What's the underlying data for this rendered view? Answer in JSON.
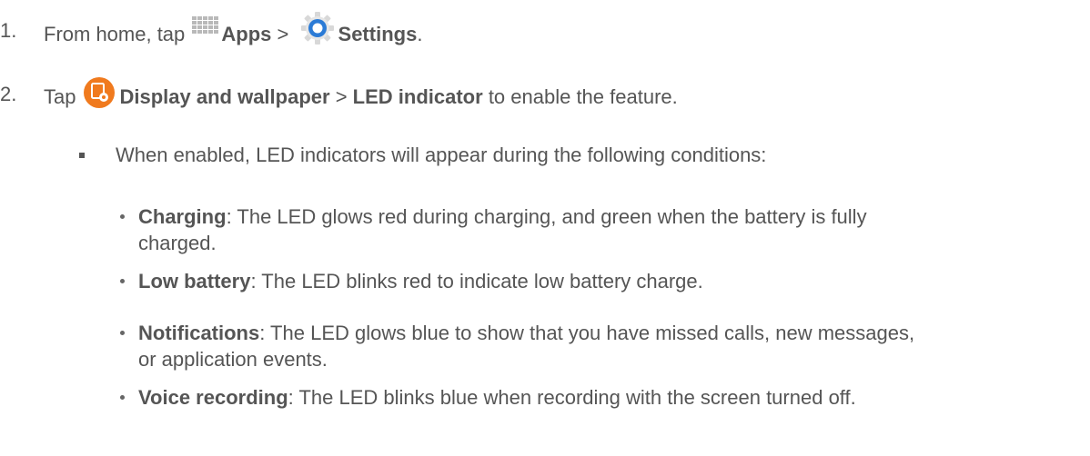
{
  "step1": {
    "number": "1.",
    "text_before": "From home, tap",
    "apps_label": "Apps",
    "separator": ">",
    "settings_label": "Settings",
    "end": "."
  },
  "step2": {
    "number": "2.",
    "text_before": "Tap",
    "display_label": "Display and wallpaper",
    "separator": ">",
    "led_label": "LED indicator",
    "text_after": "to enable the feature."
  },
  "note": {
    "text": "When enabled, LED indicators will appear during the following conditions:"
  },
  "conditions": [
    {
      "label": "Charging",
      "line1": ": The LED glows red during charging, and green when the battery is fully",
      "line2": "charged."
    },
    {
      "label": "Low battery",
      "line1": ": The LED blinks red to indicate low battery charge."
    },
    {
      "label": "Notifications",
      "line1": ": The LED glows blue to show that you have missed calls, new messages,",
      "line2": "or application events."
    },
    {
      "label": "Voice recording",
      "line1": ": The LED blinks blue when recording with the screen turned off."
    }
  ],
  "icons": {
    "apps": "apps-grid-icon",
    "settings": "settings-gear-icon",
    "display": "display-wallpaper-icon"
  },
  "colors": {
    "text": "#555555",
    "apps_icon": "#b5b5b5",
    "settings_blue": "#2b7bd6",
    "display_orange": "#f07a1e"
  }
}
